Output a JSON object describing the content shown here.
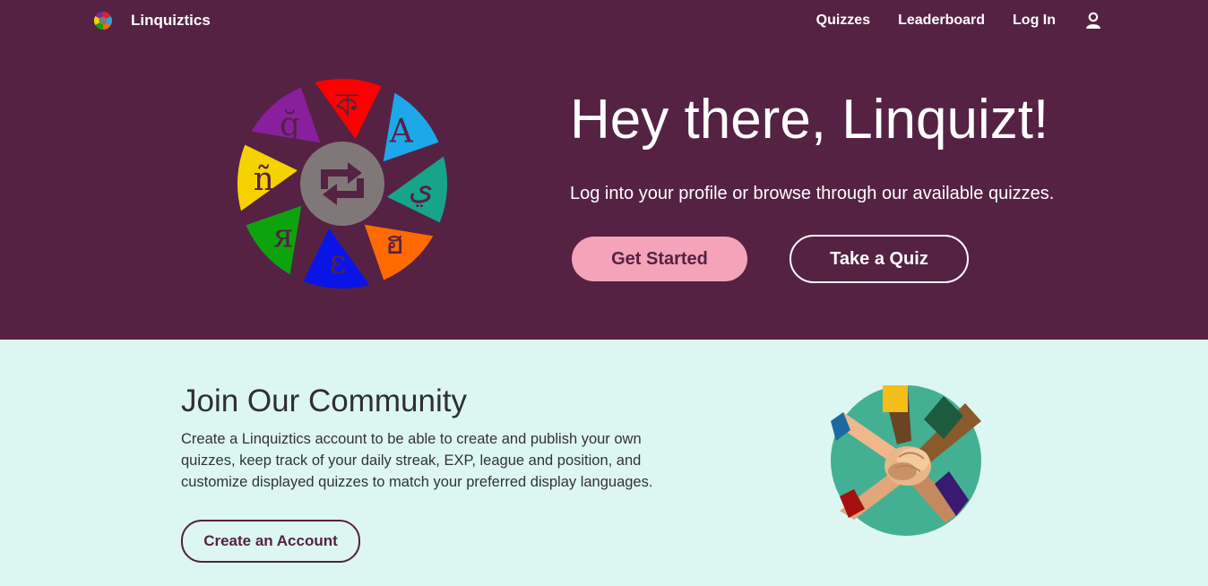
{
  "brand": {
    "name": "Linquiztics"
  },
  "nav": {
    "quizzes": "Quizzes",
    "leaderboard": "Leaderboard",
    "login": "Log In",
    "user_icon": "user-icon"
  },
  "hero": {
    "title": "Hey there, Linquizt!",
    "subtitle": "Log into your profile or browse through our available quizzes.",
    "get_started": "Get Started",
    "take_quiz": "Take a Quiz",
    "logo_glyphs": [
      "ক",
      "A",
      "ي",
      "ฮ",
      "ɛ",
      "я",
      "ñ",
      "ğ"
    ],
    "logo_colors": [
      "#ff0000",
      "#1ea7e9",
      "#16a58a",
      "#ff6a00",
      "#0a14e6",
      "#0da30d",
      "#f5d200",
      "#8a1f9e"
    ]
  },
  "community": {
    "title": "Join Our Community",
    "text": "Create a Linquiztics account to be able to create and publish your own quizzes, keep track of your daily streak, EXP, league and position, and customize displayed quizzes to match your preferred display languages.",
    "create_account": "Create an Account"
  },
  "colors": {
    "hero_bg": "#552244",
    "lower_bg": "#dcf7f1",
    "accent_pink": "#f4a3b8",
    "sync_circle": "#807878",
    "illustration_bg": "#43b093"
  }
}
